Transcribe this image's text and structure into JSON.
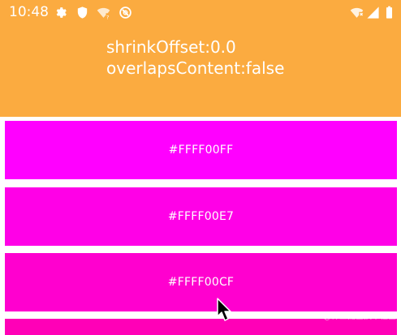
{
  "status_bar": {
    "time": "10:48",
    "left_icons": [
      "gear-icon",
      "shield-icon",
      "wifi-question-icon",
      "no-entry-icon"
    ],
    "right_icons": [
      "wifi-signal-icon",
      "cellular-signal-icon",
      "battery-icon"
    ]
  },
  "header": {
    "background": "#fbab40",
    "shrink_offset": "shrinkOffset:0.0",
    "overlaps_content": "overlapsContent:false"
  },
  "tiles": [
    {
      "label": "#FFFF00FF",
      "color": "#ff00ff"
    },
    {
      "label": "#FFFF00E7",
      "color": "#ff00e7"
    },
    {
      "label": "#FFFF00CF",
      "color": "#ff00cf"
    },
    {
      "label": "",
      "color": "#ff00b7"
    }
  ],
  "watermark": "@稀土掘金技术社区"
}
